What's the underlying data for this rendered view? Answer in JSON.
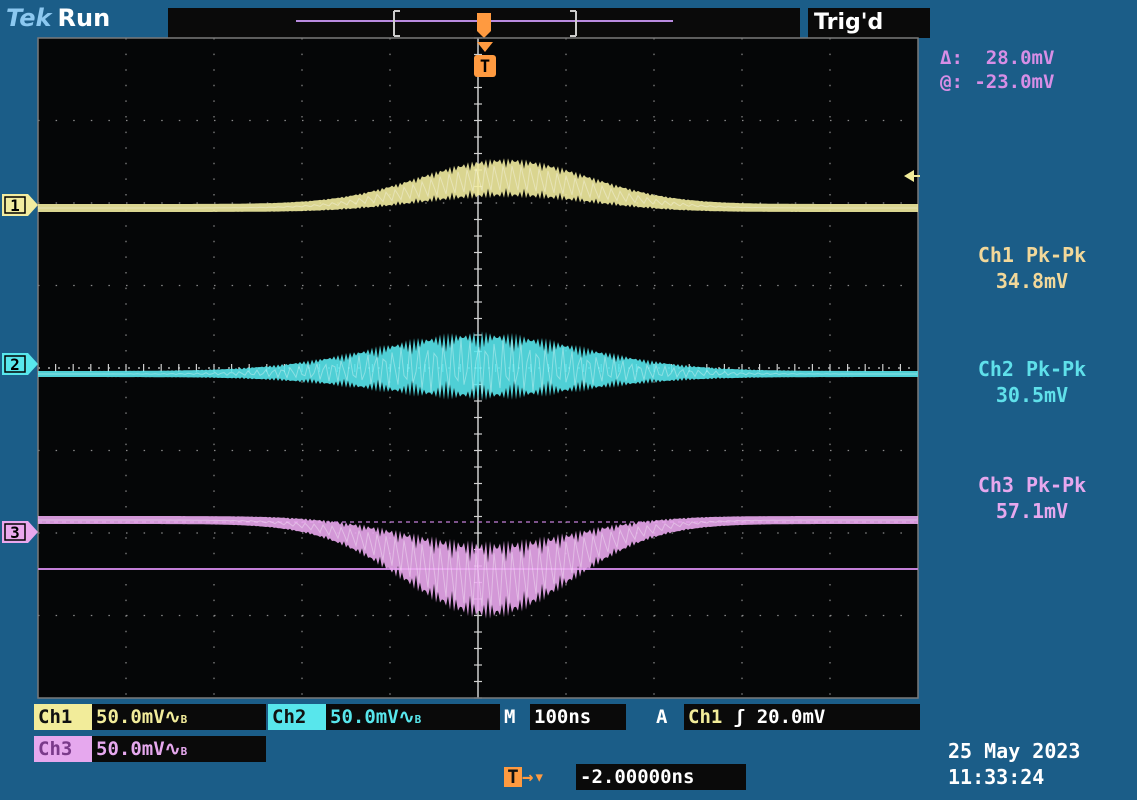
{
  "header": {
    "brand": "Tek",
    "run_state": "Run",
    "trigger_status": "Trig'd"
  },
  "cursor": {
    "delta_label": "Δ:",
    "delta_value": "28.0mV",
    "at_label": "@:",
    "at_value": "-23.0mV"
  },
  "channels": [
    {
      "id": "1",
      "color": "#f2eca0",
      "marker": "1"
    },
    {
      "id": "2",
      "color": "#58e6ec",
      "marker": "2"
    },
    {
      "id": "3",
      "color": "#eaa8ee",
      "marker": "3"
    }
  ],
  "measurements": [
    {
      "title": "Ch1 Pk-Pk",
      "value": "34.8mV",
      "color": "#f2d89a"
    },
    {
      "title": "Ch2 Pk-Pk",
      "value": "30.5mV",
      "color": "#5fe0ea"
    },
    {
      "title": "Ch3 Pk-Pk",
      "value": "57.1mV",
      "color": "#e6a8ee"
    }
  ],
  "status_bar": {
    "ch1_label": "Ch1",
    "ch1_scale": "50.0mV",
    "ch2_label": "Ch2",
    "ch2_scale": "50.0mV",
    "ch3_label": "Ch3",
    "ch3_scale": "50.0mV",
    "coupling_symbol": "∿",
    "bw_symbol": "B",
    "timebase_label": "M",
    "timebase": "100ns",
    "trigger_mode": "A",
    "trigger_source": "Ch1",
    "trigger_slope_symbol": "ʃ",
    "trigger_level": "20.0mV",
    "position_marker": "T",
    "position_value": "-2.00000ns"
  },
  "datetime": {
    "date": "25 May 2023",
    "time": "11:33:24"
  },
  "trigger_marker": "T"
}
